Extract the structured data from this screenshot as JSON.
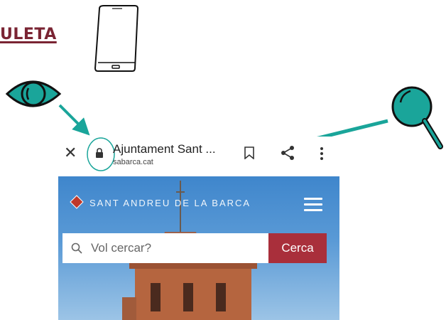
{
  "heading": {
    "text": "ULETA"
  },
  "icons": {
    "phone": "phone-icon",
    "eye": "eye-icon",
    "magnifier": "magnifier-icon",
    "accent_color": "#1aa59a"
  },
  "browser": {
    "close_glyph": "✕",
    "page_title": "Ajuntament Sant ...",
    "url": "sabarca.cat",
    "icons": [
      "lock-icon",
      "bookmark-icon",
      "share-icon",
      "more-menu-icon"
    ]
  },
  "site": {
    "name": "SANT ANDREU DE LA BARCA",
    "search": {
      "placeholder": "Vol cercar?",
      "button_label": "Cerca"
    },
    "colors": {
      "button": "#a92f3b",
      "sky": "#3f86cc"
    }
  }
}
